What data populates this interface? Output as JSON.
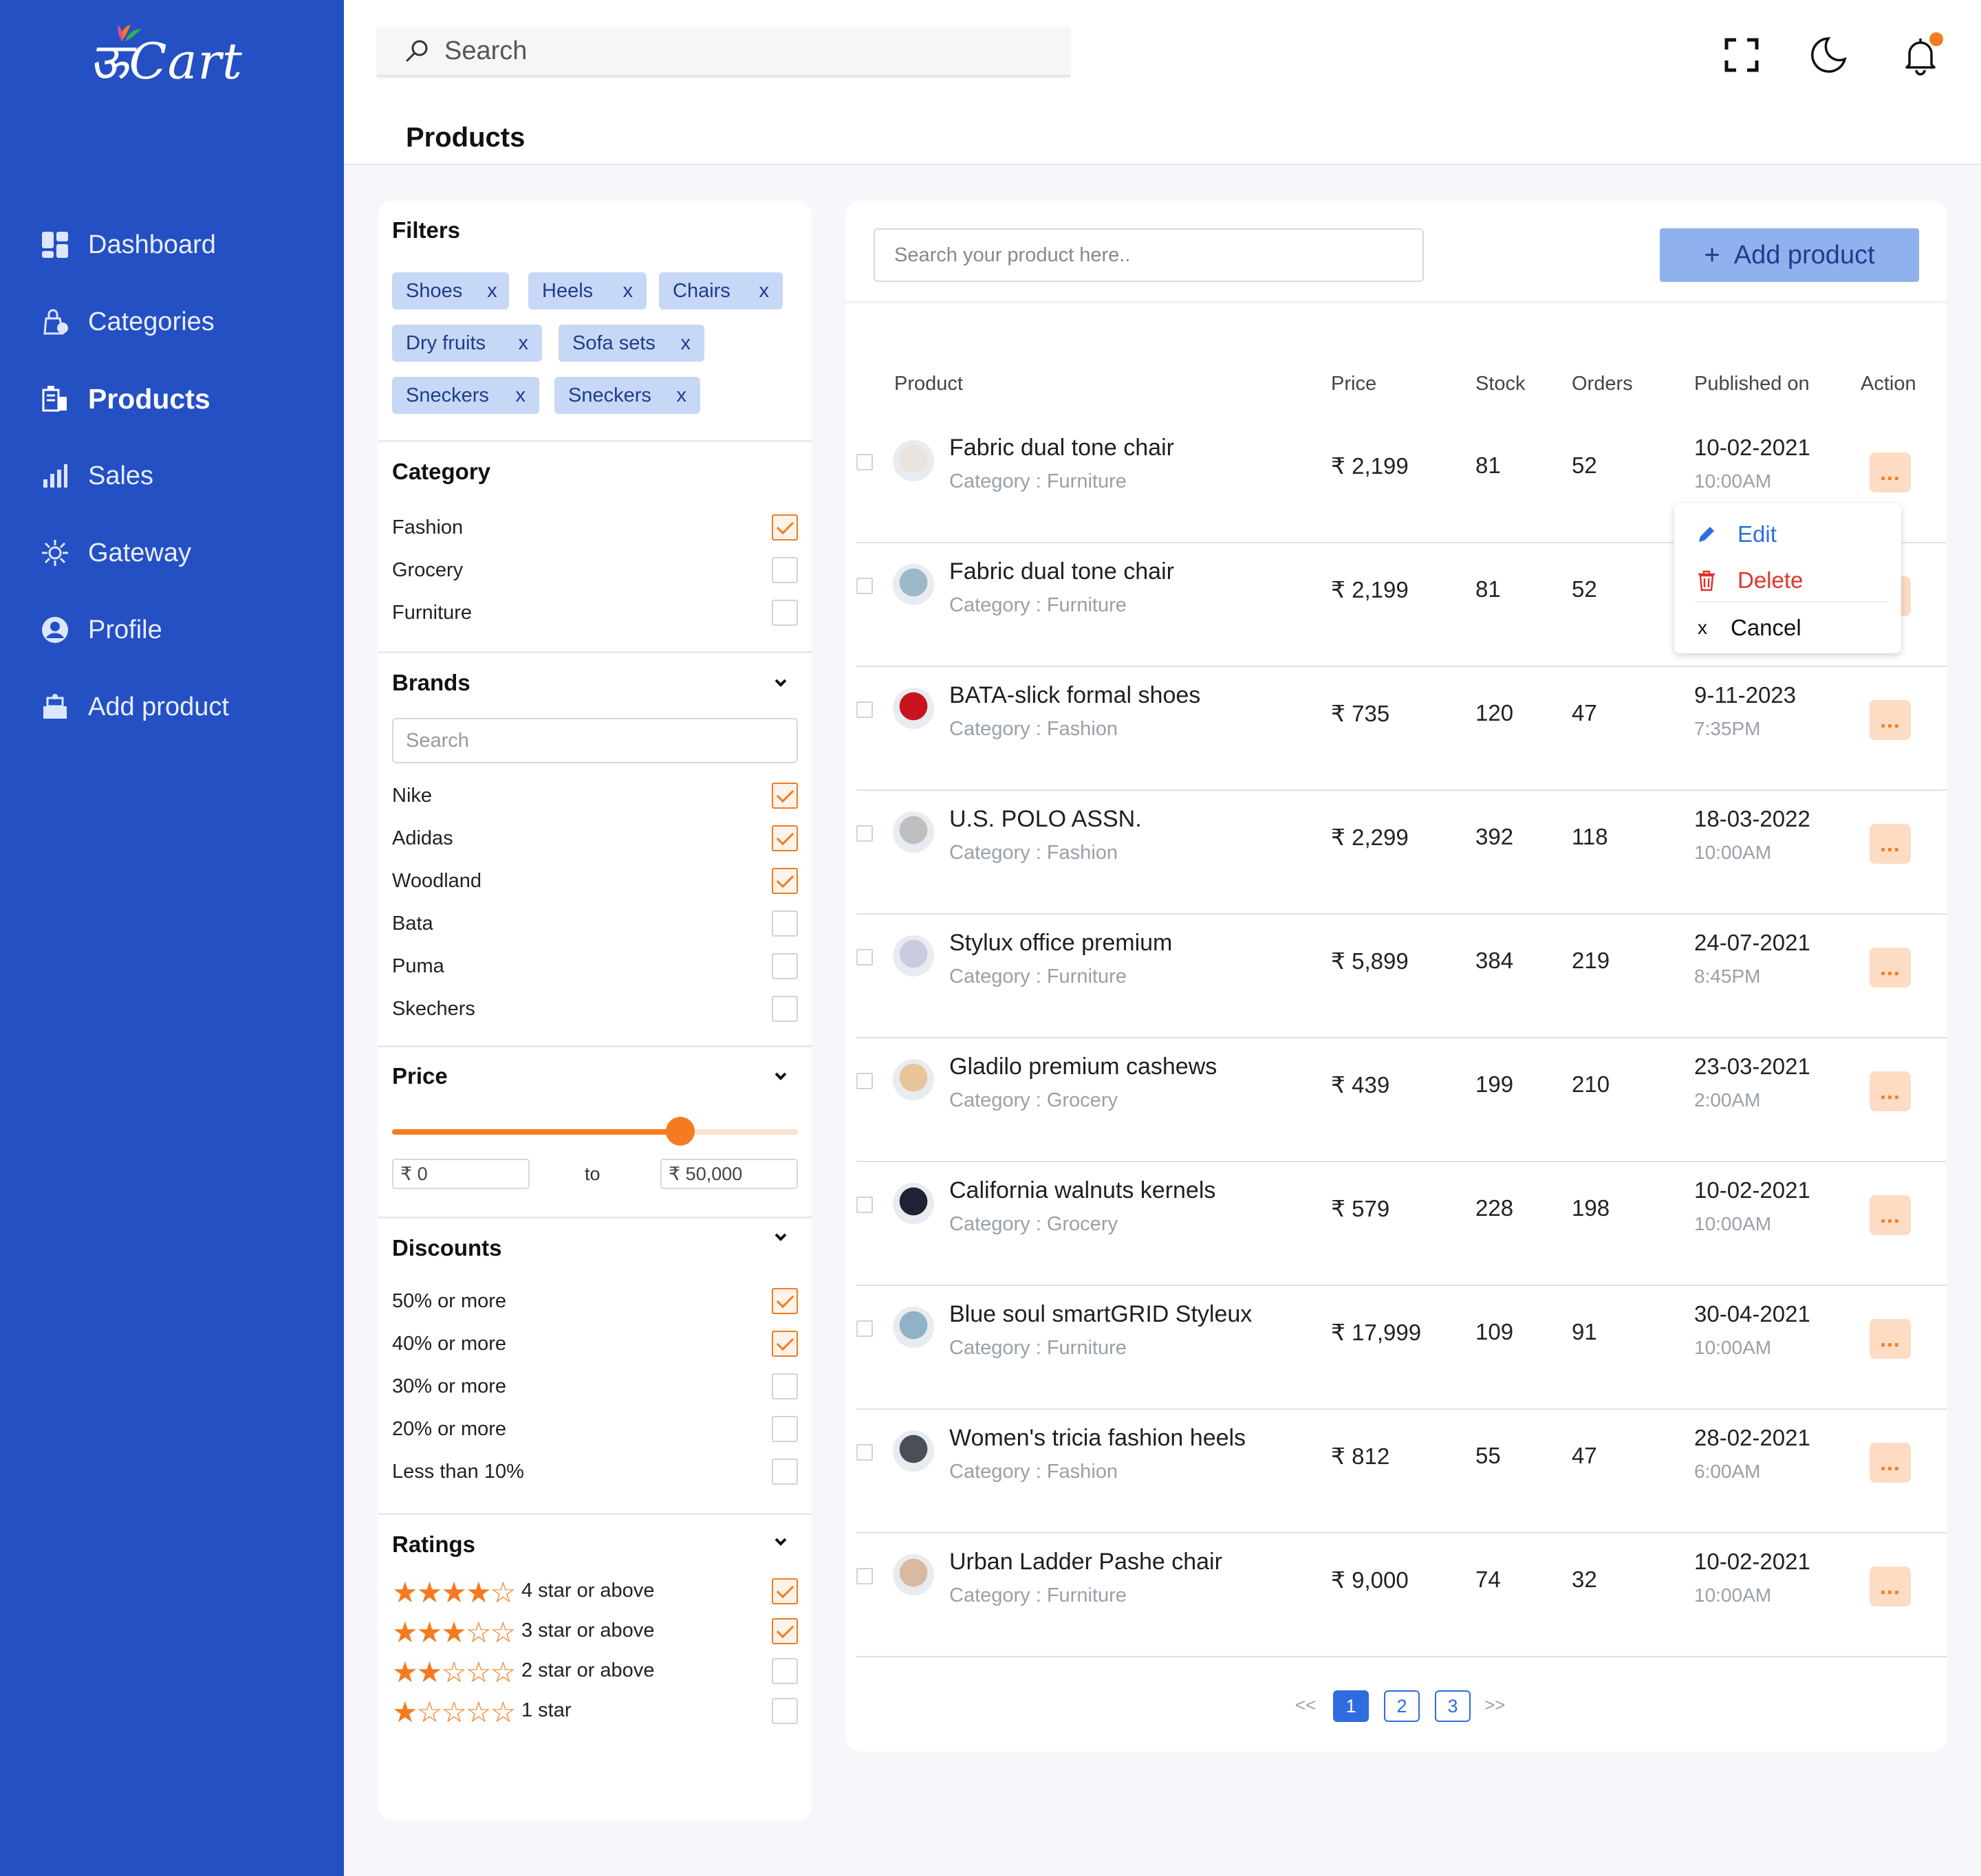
{
  "brand": {
    "logo_text": "ऊCart",
    "accent": "#2450C4"
  },
  "sidebar": {
    "items": [
      {
        "label": "Dashboard",
        "icon": "dashboard-icon"
      },
      {
        "label": "Categories",
        "icon": "categories-icon"
      },
      {
        "label": "Products",
        "icon": "products-icon",
        "active": true
      },
      {
        "label": "Sales",
        "icon": "sales-icon"
      },
      {
        "label": "Gateway",
        "icon": "gateway-icon"
      },
      {
        "label": "Profile",
        "icon": "profile-icon"
      },
      {
        "label": "Add product",
        "icon": "add-product-icon"
      }
    ]
  },
  "topbar": {
    "search_placeholder": "Search",
    "icons": [
      "fullscreen-icon",
      "dark-mode-icon",
      "notification-bell-icon"
    ]
  },
  "page": {
    "title": "Products"
  },
  "filters": {
    "title": "Filters",
    "chips": [
      "Shoes",
      "Heels",
      "Chairs",
      "Dry fruits",
      "Sofa sets",
      "Sneckers",
      "Sneckers"
    ],
    "chip_remove": "x",
    "category": {
      "title": "Category",
      "options": [
        {
          "label": "Fashion",
          "checked": true
        },
        {
          "label": "Grocery",
          "checked": false
        },
        {
          "label": "Furniture",
          "checked": false
        }
      ]
    },
    "brands": {
      "title": "Brands",
      "search_placeholder": "Search",
      "options": [
        {
          "label": "Nike",
          "checked": true
        },
        {
          "label": "Adidas",
          "checked": true
        },
        {
          "label": "Woodland",
          "checked": true
        },
        {
          "label": "Bata",
          "checked": false
        },
        {
          "label": "Puma",
          "checked": false
        },
        {
          "label": "Skechers",
          "checked": false
        }
      ]
    },
    "price": {
      "title": "Price",
      "slider_level": 0.71,
      "min_value": "₹ 0",
      "to_label": "to",
      "max_value": "₹ 50,000"
    },
    "discounts": {
      "title": "Discounts",
      "options": [
        {
          "label": "50% or more",
          "checked": true
        },
        {
          "label": "40% or more",
          "checked": true
        },
        {
          "label": "30% or more",
          "checked": false
        },
        {
          "label": "20% or more",
          "checked": false
        },
        {
          "label": "Less than 10%",
          "checked": false
        }
      ]
    },
    "ratings": {
      "title": "Ratings",
      "options": [
        {
          "stars": 4,
          "label": "4 star or above",
          "checked": true
        },
        {
          "stars": 3,
          "label": "3 star or above",
          "checked": true
        },
        {
          "stars": 2,
          "label": "2 star or above",
          "checked": false
        },
        {
          "stars": 1,
          "label": "1 star",
          "checked": false
        }
      ]
    }
  },
  "products": {
    "search_placeholder": "Search your product here..",
    "add_button": "Add product",
    "add_button_plus": "+",
    "columns": [
      "Product",
      "Price",
      "Stock",
      "Orders",
      "Published on",
      "Action"
    ],
    "rows": [
      {
        "name": "Fabric dual tone chair",
        "category": "Category : Furniture",
        "price": "₹ 2,199",
        "stock": "81",
        "orders": "52",
        "date": "10-02-2021",
        "time": "10:00AM",
        "thumb_color": "#E9E4DE"
      },
      {
        "name": "Fabric dual tone chair",
        "category": "Category : Furniture",
        "price": "₹ 2,199",
        "stock": "81",
        "orders": "52",
        "date": "",
        "time": "",
        "thumb_color": "#9DB8C8"
      },
      {
        "name": "BATA-slick formal shoes",
        "category": "Category : Fashion",
        "price": "₹ 735",
        "stock": "120",
        "orders": "47",
        "date": "9-11-2023",
        "time": "7:35PM",
        "thumb_color": "#C8141E"
      },
      {
        "name": "U.S. POLO ASSN.",
        "category": "Category : Fashion",
        "price": "₹ 2,299",
        "stock": "392",
        "orders": "118",
        "date": "18-03-2022",
        "time": "10:00AM",
        "thumb_color": "#BFBFBF"
      },
      {
        "name": "Stylux office premium",
        "category": "Category : Furniture",
        "price": "₹ 5,899",
        "stock": "384",
        "orders": "219",
        "date": "24-07-2021",
        "time": "8:45PM",
        "thumb_color": "#C9CCE0"
      },
      {
        "name": "Gladilo premium cashews",
        "category": "Category : Grocery",
        "price": "₹ 439",
        "stock": "199",
        "orders": "210",
        "date": "23-03-2021",
        "time": "2:00AM",
        "thumb_color": "#E7C49A"
      },
      {
        "name": "California walnuts kernels",
        "category": "Category : Grocery",
        "price": "₹ 579",
        "stock": "228",
        "orders": "198",
        "date": "10-02-2021",
        "time": "10:00AM",
        "thumb_color": "#1E2233"
      },
      {
        "name": "Blue soul smartGRID Styleux",
        "category": "Category : Furniture",
        "price": "₹ 17,999",
        "stock": "109",
        "orders": "91",
        "date": "30-04-2021",
        "time": "10:00AM",
        "thumb_color": "#8FB3C5"
      },
      {
        "name": "Women's tricia fashion heels",
        "category": "Category : Fashion",
        "price": "₹ 812",
        "stock": "55",
        "orders": "47",
        "date": "28-02-2021",
        "time": "6:00AM",
        "thumb_color": "#4A4F57"
      },
      {
        "name": "Urban Ladder Pashe chair",
        "category": "Category : Furniture",
        "price": "₹ 9,000",
        "stock": "74",
        "orders": "32",
        "date": "10-02-2021",
        "time": "10:00AM",
        "thumb_color": "#D9B9A0"
      }
    ],
    "action_label": "...",
    "menu": {
      "edit": "Edit",
      "delete": "Delete",
      "cancel": "Cancel",
      "cancel_icon": "x"
    },
    "pagination": {
      "prev": "<<",
      "pages": [
        "1",
        "2",
        "3"
      ],
      "current": "1",
      "next": ">>"
    }
  }
}
